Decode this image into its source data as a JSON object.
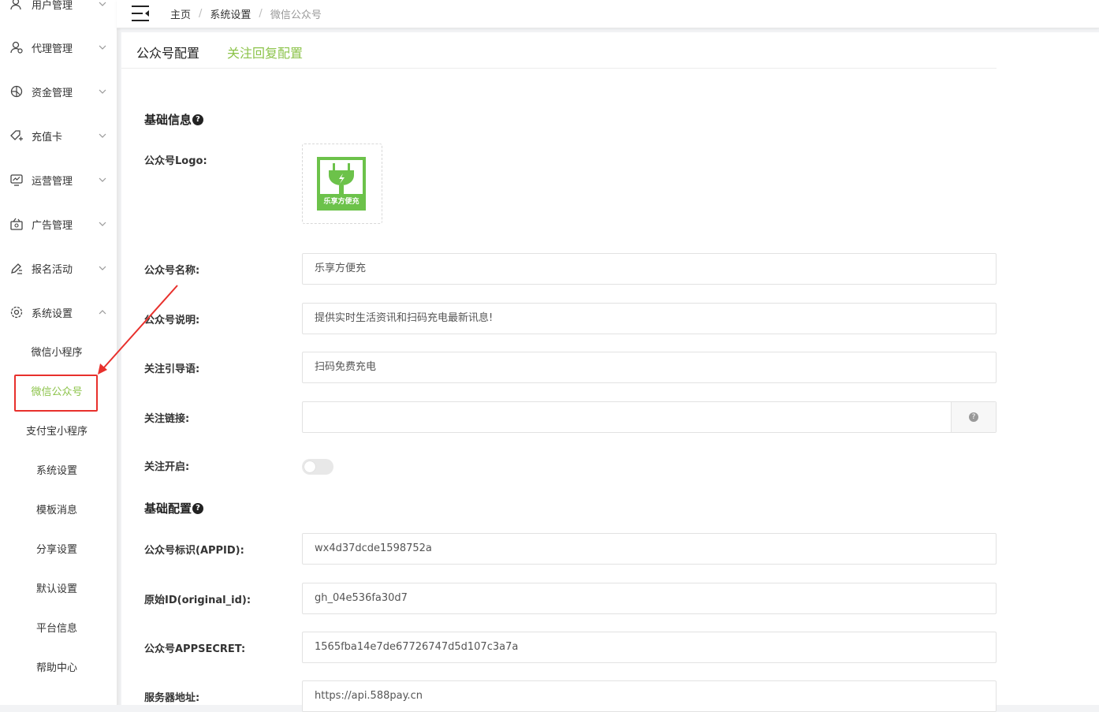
{
  "sidebar": {
    "items": [
      {
        "label": "用户管理",
        "icon": "user-icon"
      },
      {
        "label": "代理管理",
        "icon": "agent-icon"
      },
      {
        "label": "资金管理",
        "icon": "funds-icon"
      },
      {
        "label": "充值卡",
        "icon": "card-icon"
      },
      {
        "label": "运营管理",
        "icon": "chart-icon"
      },
      {
        "label": "广告管理",
        "icon": "ad-icon"
      },
      {
        "label": "报名活动",
        "icon": "edit-icon"
      },
      {
        "label": "系统设置",
        "icon": "gear-icon"
      }
    ],
    "sub_items": [
      {
        "label": "微信小程序"
      },
      {
        "label": "微信公众号"
      },
      {
        "label": "支付宝小程序"
      },
      {
        "label": "系统设置"
      },
      {
        "label": "模板消息"
      },
      {
        "label": "分享设置"
      },
      {
        "label": "默认设置"
      },
      {
        "label": "平台信息"
      },
      {
        "label": "帮助中心"
      }
    ],
    "active_sub": "微信公众号"
  },
  "breadcrumb": [
    "主页",
    "系统设置",
    "微信公众号"
  ],
  "breadcrumb_sep": "/",
  "tabs": [
    "公众号配置",
    "关注回复配置"
  ],
  "sections": {
    "basic_info": "基础信息",
    "basic_config": "基础配置"
  },
  "help_glyph": "?",
  "logo": {
    "label": "公众号Logo:",
    "caption": "乐享方便充",
    "color": "#6cc24a"
  },
  "form": {
    "name": {
      "label": "公众号名称:",
      "value": "乐享方便充"
    },
    "desc": {
      "label": "公众号说明:",
      "value": "提供实时生活资讯和扫码充电最新讯息!"
    },
    "guide": {
      "label": "关注引导语:",
      "value": "扫码免费充电"
    },
    "link": {
      "label": "关注链接:",
      "value": ""
    },
    "follow_open": {
      "label": "关注开启:",
      "value": false
    },
    "appid": {
      "label": "公众号标识(APPID):",
      "value": "wx4d37dcde1598752a"
    },
    "original_id": {
      "label": "原始ID(original_id):",
      "value": "gh_04e536fa30d7"
    },
    "appsecret": {
      "label": "公众号APPSECRET:",
      "value": "1565fba14e7de67726747d5d107c3a7a"
    },
    "server": {
      "label": "服务器地址:",
      "value": "https://api.588pay.cn"
    }
  },
  "colors": {
    "accent": "#8cc34a",
    "annotation": "#e8302c"
  }
}
